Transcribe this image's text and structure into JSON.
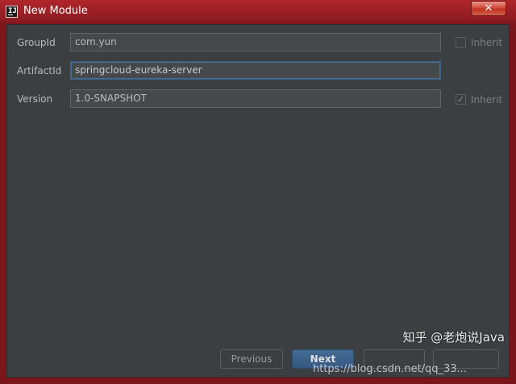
{
  "window": {
    "title": "New Module",
    "app_icon_text": "IJ",
    "close_glyph": "✕"
  },
  "form": {
    "group_id": {
      "label": "GroupId",
      "value": "com.yun",
      "inherit_label": "Inherit",
      "inherit_checked": false
    },
    "artifact_id": {
      "label": "ArtifactId",
      "value": "springcloud-eureka-server"
    },
    "version": {
      "label": "Version",
      "value": "1.0-SNAPSHOT",
      "inherit_label": "Inherit",
      "inherit_checked": true,
      "check_glyph": "✓"
    }
  },
  "buttons": {
    "previous": "Previous",
    "next": "Next"
  },
  "watermark": {
    "text": "知乎 @老炮说Java",
    "url": "https://blog.csdn.net/qq_33..."
  },
  "colors": {
    "window_frame": "#8e1c21",
    "panel": "#3c3f41",
    "field_bg": "#45494a",
    "accent": "#365880"
  }
}
